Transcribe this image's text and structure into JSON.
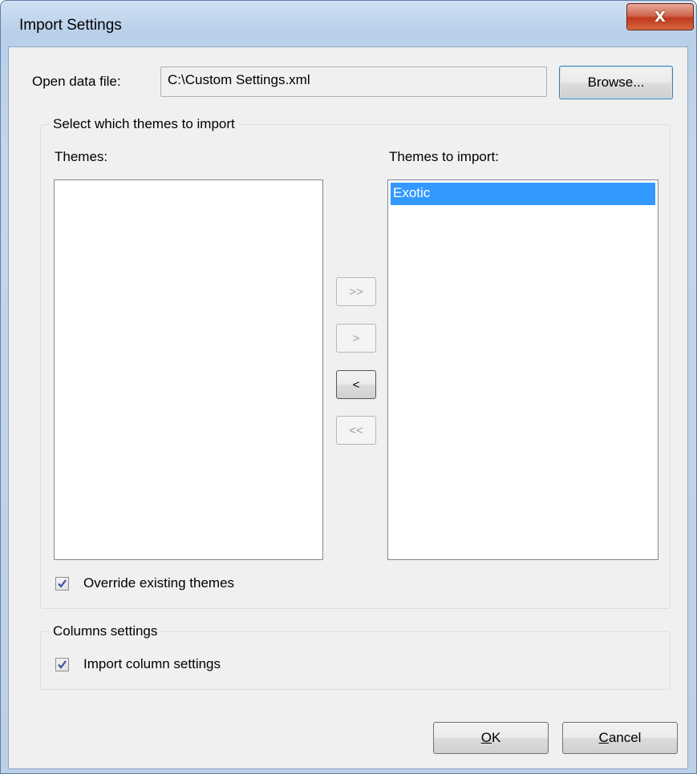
{
  "window": {
    "title": "Import Settings",
    "close_glyph": "X"
  },
  "open_file": {
    "label": "Open data file:",
    "value": "C:\\Custom Settings.xml",
    "browse_label": "Browse..."
  },
  "themes_group": {
    "title": "Select which themes to import",
    "available_label": "Themes:",
    "available_items": [],
    "import_label": "Themes to import:",
    "import_items": [
      "Exotic"
    ],
    "add_all_label": ">>",
    "add_label": ">",
    "remove_label": "<",
    "remove_all_label": "<<",
    "override_label": "Override existing themes",
    "override_checked": true
  },
  "columns_group": {
    "title": "Columns settings",
    "import_columns_label": "Import column settings",
    "import_columns_checked": true
  },
  "footer": {
    "ok_mnemonic": "O",
    "ok_rest": "K",
    "cancel_mnemonic": "C",
    "cancel_rest": "ancel"
  },
  "colors": {
    "selection": "#3399ff",
    "close_button": "#c7442a"
  }
}
